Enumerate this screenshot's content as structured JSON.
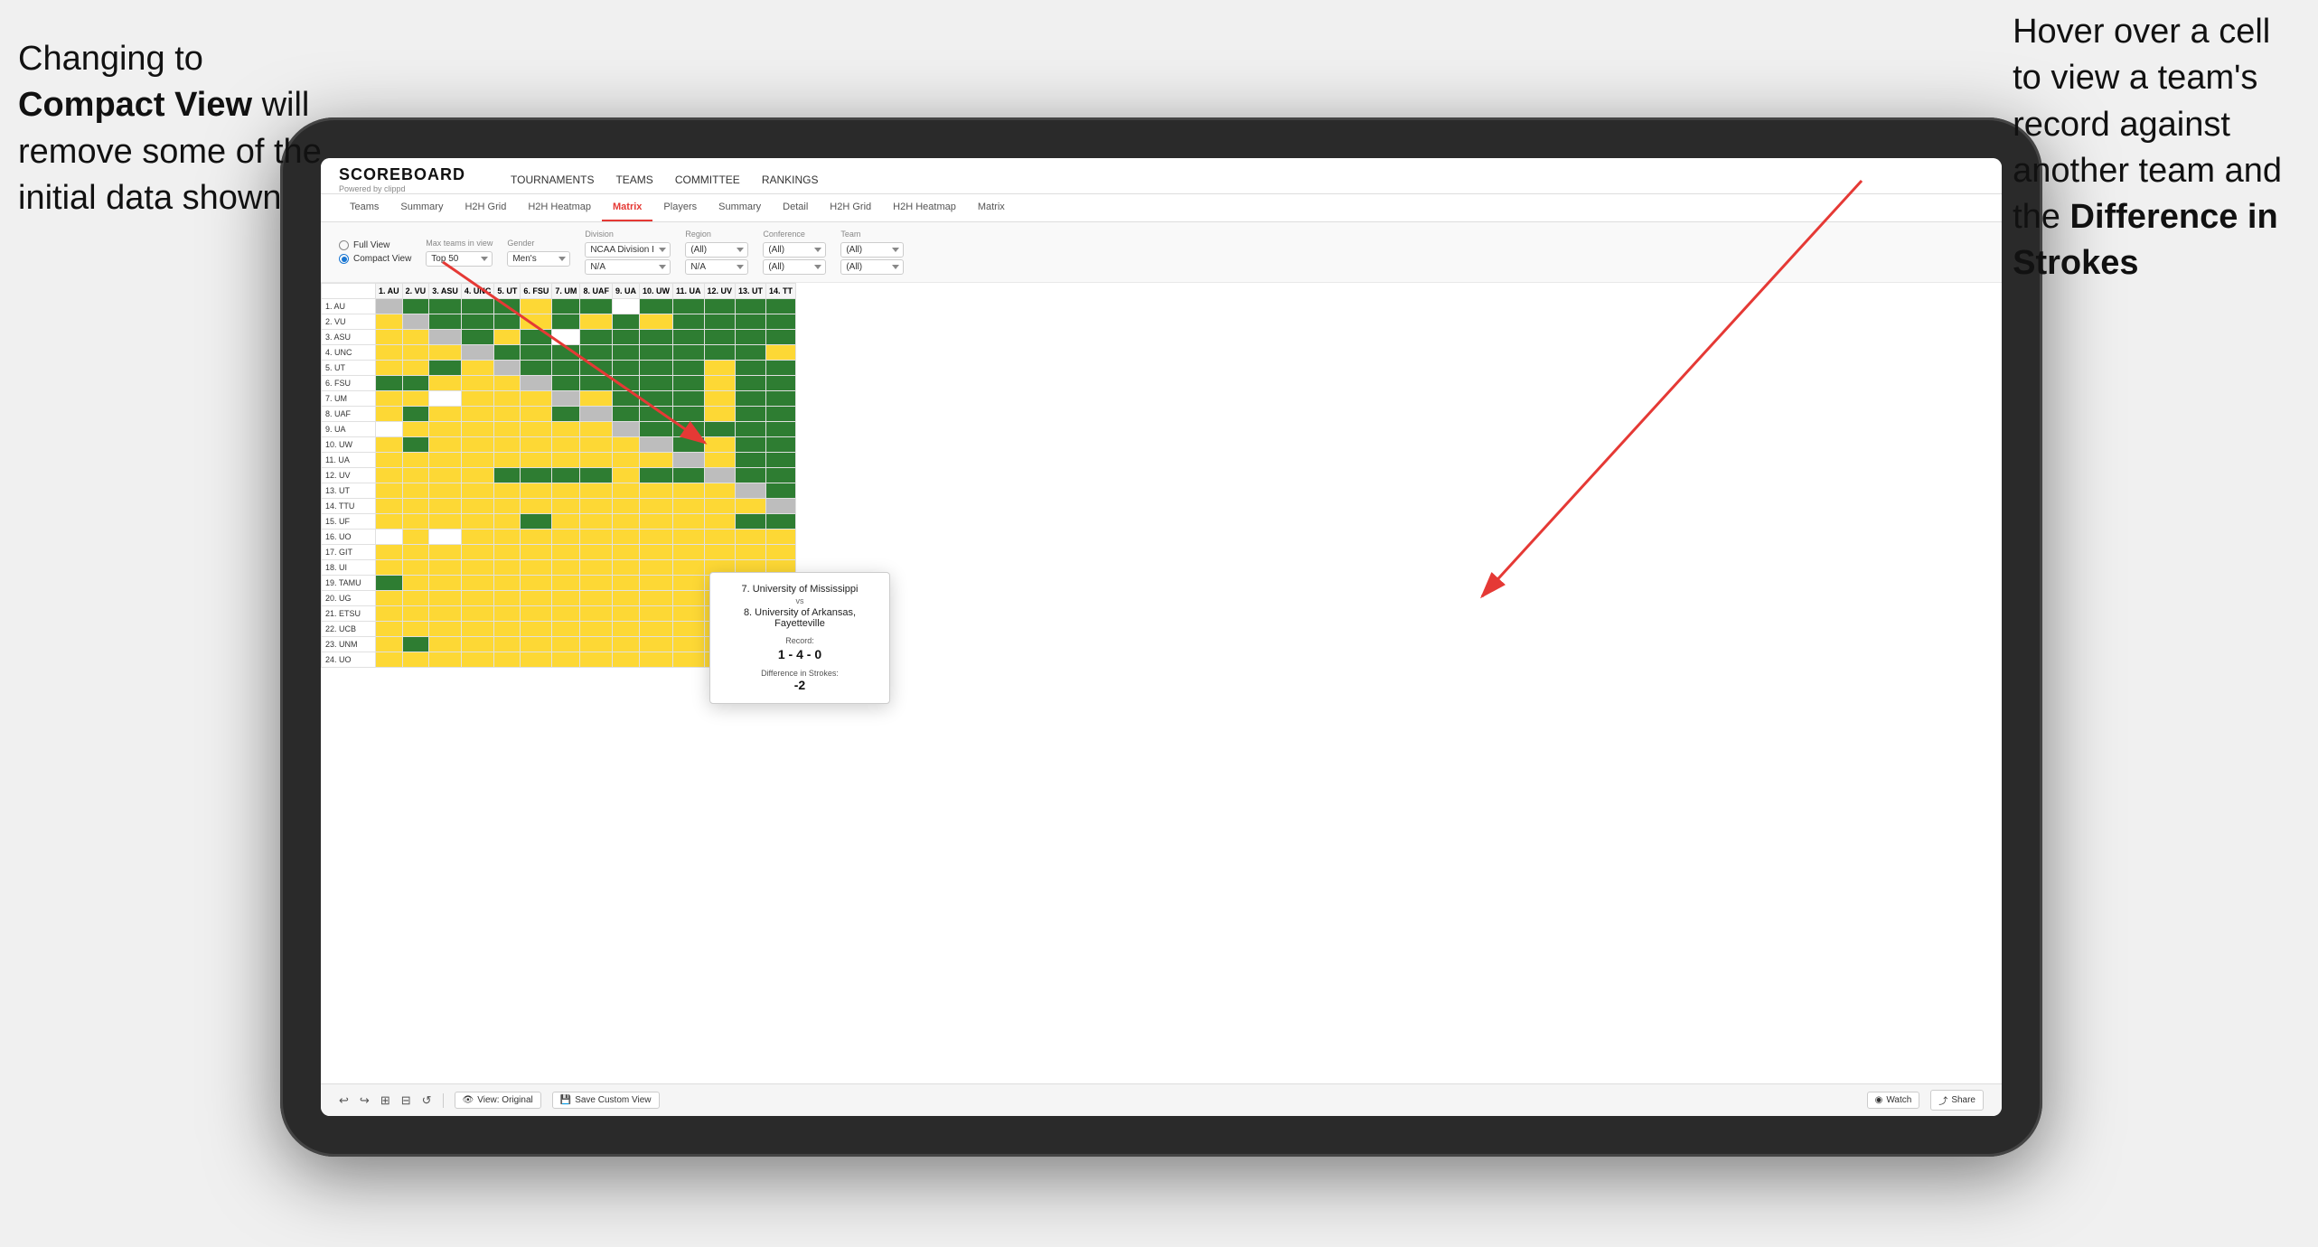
{
  "annotation_left": {
    "line1": "Changing to",
    "line2_bold": "Compact View",
    "line2_rest": " will",
    "line3": "remove some of the",
    "line4": "initial data shown"
  },
  "annotation_right": {
    "line1": "Hover over a cell",
    "line2": "to view a team's",
    "line3": "record against",
    "line4": "another team and",
    "line5_pre": "the ",
    "line5_bold": "Difference in",
    "line6_bold": "Strokes"
  },
  "app": {
    "logo": "SCOREBOARD",
    "logo_sub": "Powered by clippd",
    "nav": [
      "TOURNAMENTS",
      "TEAMS",
      "COMMITTEE",
      "RANKINGS"
    ],
    "sub_tabs": [
      "Teams",
      "Summary",
      "H2H Grid",
      "H2H Heatmap",
      "Matrix",
      "Players",
      "Summary",
      "Detail",
      "H2H Grid",
      "H2H Heatmap",
      "Matrix"
    ],
    "active_tab": "Matrix"
  },
  "controls": {
    "view_full": "Full View",
    "view_compact": "Compact View",
    "active_view": "compact",
    "filters": [
      {
        "label": "Max teams in view",
        "value": "Top 50"
      },
      {
        "label": "Gender",
        "value": "Men's"
      },
      {
        "label": "Division",
        "value": "NCAA Division I",
        "value2": "N/A"
      },
      {
        "label": "Region",
        "value": "(All)",
        "value2": "N/A"
      },
      {
        "label": "Conference",
        "value": "(All)",
        "value2": "(All)"
      },
      {
        "label": "Team",
        "value": "(All)",
        "value2": "(All)"
      }
    ]
  },
  "col_headers": [
    "1. AU",
    "2. VU",
    "3. ASU",
    "4. UNC",
    "5. UT",
    "6. FSU",
    "7. UM",
    "8. UAF",
    "9. UA",
    "10. UW",
    "11. UA",
    "12. UV",
    "13. UT",
    "14. TT"
  ],
  "rows": [
    {
      "label": "1. AU",
      "cells": [
        "self",
        "g",
        "g",
        "g",
        "g",
        "y",
        "g",
        "g",
        "w",
        "g",
        "g",
        "g",
        "g",
        "g"
      ]
    },
    {
      "label": "2. VU",
      "cells": [
        "y",
        "self",
        "g",
        "g",
        "g",
        "y",
        "g",
        "y",
        "g",
        "y",
        "g",
        "g",
        "g",
        "g"
      ]
    },
    {
      "label": "3. ASU",
      "cells": [
        "y",
        "y",
        "self",
        "g",
        "y",
        "g",
        "w",
        "g",
        "g",
        "g",
        "g",
        "g",
        "g",
        "g"
      ]
    },
    {
      "label": "4. UNC",
      "cells": [
        "y",
        "y",
        "y",
        "self",
        "g",
        "g",
        "g",
        "g",
        "g",
        "g",
        "g",
        "g",
        "g",
        "y"
      ]
    },
    {
      "label": "5. UT",
      "cells": [
        "y",
        "y",
        "g",
        "y",
        "self",
        "g",
        "g",
        "g",
        "g",
        "g",
        "g",
        "y",
        "g",
        "g"
      ]
    },
    {
      "label": "6. FSU",
      "cells": [
        "g",
        "g",
        "y",
        "y",
        "y",
        "self",
        "g",
        "g",
        "g",
        "g",
        "g",
        "y",
        "g",
        "g"
      ]
    },
    {
      "label": "7. UM",
      "cells": [
        "y",
        "y",
        "w",
        "y",
        "y",
        "y",
        "self",
        "y",
        "g",
        "g",
        "g",
        "y",
        "g",
        "g"
      ]
    },
    {
      "label": "8. UAF",
      "cells": [
        "y",
        "g",
        "y",
        "y",
        "y",
        "y",
        "g",
        "self",
        "g",
        "g",
        "g",
        "y",
        "g",
        "g"
      ]
    },
    {
      "label": "9. UA",
      "cells": [
        "w",
        "y",
        "y",
        "y",
        "y",
        "y",
        "y",
        "y",
        "self",
        "g",
        "g",
        "g",
        "g",
        "g"
      ]
    },
    {
      "label": "10. UW",
      "cells": [
        "y",
        "g",
        "y",
        "y",
        "y",
        "y",
        "y",
        "y",
        "y",
        "self",
        "g",
        "y",
        "g",
        "g"
      ]
    },
    {
      "label": "11. UA",
      "cells": [
        "y",
        "y",
        "y",
        "y",
        "y",
        "y",
        "y",
        "y",
        "y",
        "y",
        "self",
        "y",
        "g",
        "g"
      ]
    },
    {
      "label": "12. UV",
      "cells": [
        "y",
        "y",
        "y",
        "y",
        "g",
        "g",
        "g",
        "g",
        "y",
        "g",
        "g",
        "self",
        "g",
        "g"
      ]
    },
    {
      "label": "13. UT",
      "cells": [
        "y",
        "y",
        "y",
        "y",
        "y",
        "y",
        "y",
        "y",
        "y",
        "y",
        "y",
        "y",
        "self",
        "g"
      ]
    },
    {
      "label": "14. TTU",
      "cells": [
        "y",
        "y",
        "y",
        "y",
        "y",
        "y",
        "y",
        "y",
        "y",
        "y",
        "y",
        "y",
        "y",
        "self"
      ]
    },
    {
      "label": "15. UF",
      "cells": [
        "y",
        "y",
        "y",
        "y",
        "y",
        "g",
        "y",
        "y",
        "y",
        "y",
        "y",
        "y",
        "g",
        "g"
      ]
    },
    {
      "label": "16. UO",
      "cells": [
        "w",
        "y",
        "w",
        "y",
        "y",
        "y",
        "y",
        "y",
        "y",
        "y",
        "y",
        "y",
        "y",
        "y"
      ]
    },
    {
      "label": "17. GIT",
      "cells": [
        "y",
        "y",
        "y",
        "y",
        "y",
        "y",
        "y",
        "y",
        "y",
        "y",
        "y",
        "y",
        "y",
        "y"
      ]
    },
    {
      "label": "18. UI",
      "cells": [
        "y",
        "y",
        "y",
        "y",
        "y",
        "y",
        "y",
        "y",
        "y",
        "y",
        "y",
        "y",
        "y",
        "y"
      ]
    },
    {
      "label": "19. TAMU",
      "cells": [
        "g",
        "y",
        "y",
        "y",
        "y",
        "y",
        "y",
        "y",
        "y",
        "y",
        "y",
        "y",
        "y",
        "y"
      ]
    },
    {
      "label": "20. UG",
      "cells": [
        "y",
        "y",
        "y",
        "y",
        "y",
        "y",
        "y",
        "y",
        "y",
        "y",
        "y",
        "y",
        "y",
        "y"
      ]
    },
    {
      "label": "21. ETSU",
      "cells": [
        "y",
        "y",
        "y",
        "y",
        "y",
        "y",
        "y",
        "y",
        "y",
        "y",
        "y",
        "y",
        "y",
        "y"
      ]
    },
    {
      "label": "22. UCB",
      "cells": [
        "y",
        "y",
        "y",
        "y",
        "y",
        "y",
        "y",
        "y",
        "y",
        "y",
        "y",
        "y",
        "y",
        "y"
      ]
    },
    {
      "label": "23. UNM",
      "cells": [
        "y",
        "g",
        "y",
        "y",
        "y",
        "y",
        "y",
        "y",
        "y",
        "y",
        "y",
        "y",
        "y",
        "y"
      ]
    },
    {
      "label": "24. UO",
      "cells": [
        "y",
        "y",
        "y",
        "y",
        "y",
        "y",
        "y",
        "y",
        "y",
        "y",
        "y",
        "y",
        "y",
        "y"
      ]
    }
  ],
  "tooltip": {
    "team1": "7. University of Mississippi",
    "vs": "vs",
    "team2": "8. University of Arkansas, Fayetteville",
    "record_label": "Record:",
    "record": "1 - 4 - 0",
    "diff_label": "Difference in Strokes:",
    "diff": "-2"
  },
  "toolbar": {
    "undo_label": "↩",
    "redo_label": "↪",
    "icons": [
      "↩",
      "↪",
      "⊞",
      "⊟",
      "⊕",
      "↺"
    ],
    "view_original": "View: Original",
    "save_custom": "Save Custom View",
    "watch": "Watch",
    "share": "Share"
  }
}
